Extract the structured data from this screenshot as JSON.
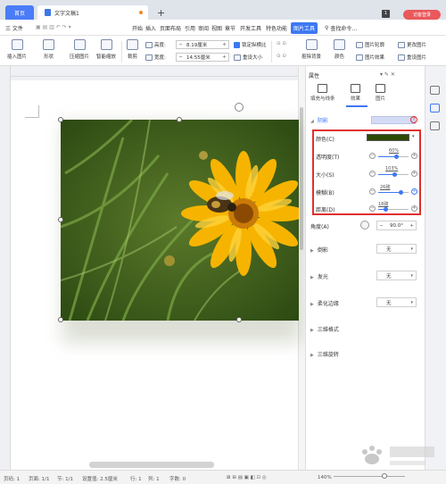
{
  "titlebar": {
    "home_tab": "首页",
    "doc_tab": "文字文稿1",
    "add_tab": "+",
    "count_badge": "1",
    "login_button": "访客登录"
  },
  "menubar": {
    "file": "三 文件",
    "items": [
      "开始",
      "插入",
      "页面布局",
      "引用",
      "审阅",
      "视图",
      "章节",
      "开发工具",
      "特色功能"
    ],
    "picture_tools": "图片工具",
    "search": "查找命令..."
  },
  "toolbar": {
    "insert_picture": "插入图片",
    "shape": "形状",
    "compress": "压缩图片",
    "smart_scale": "智能缩放",
    "crop": "裁剪",
    "height_label": "高度:",
    "height_value": "8.19厘米",
    "width_label": "宽度:",
    "width_value": "14.55厘米",
    "lock_ratio": "锁定纵横比",
    "reset_size": "重设大小",
    "cutout": "抠除背景",
    "color": "颜色",
    "picture_outline": "图片轮廓",
    "picture_effects": "图片效果",
    "change_picture": "更改图片",
    "reset_picture": "重设图片"
  },
  "panel": {
    "header": "属性",
    "tabs": [
      "填充与线条",
      "效果",
      "图片"
    ],
    "shadow_section": "阴影",
    "color_label": "颜色(C)",
    "transparency_label": "透明度(T)",
    "transparency_value": "60%",
    "transparency_pct": 60,
    "size_label": "大小(S)",
    "size_value": "103%",
    "size_pct": 55,
    "blur_label": "模糊(B)",
    "blur_value": "26磅",
    "blur_pct": 75,
    "distance_label": "距离(D)",
    "distance_value": "18磅",
    "distance_pct": 25,
    "angle_label": "角度(A)",
    "angle_value": "90.0°",
    "reflection_label": "倒影",
    "reflection_value": "无",
    "glow_label": "发光",
    "glow_value": "无",
    "soft_edges_label": "柔化边缘",
    "soft_edges_value": "无",
    "format_3d": "三维格式",
    "rotation_3d": "三维旋转",
    "help": "?"
  },
  "statusbar": {
    "page_num": "页码: 1",
    "pages": "页面: 1/1",
    "section": "节: 1/1",
    "setting": "设置值: 2.5厘米",
    "row": "行: 1",
    "col": "列: 1",
    "words": "字数: 0",
    "zoom": "140%"
  },
  "colors": {
    "accent": "#3d78f2",
    "shadow_color": "#2d4a00",
    "highlight": "#e0302e"
  }
}
